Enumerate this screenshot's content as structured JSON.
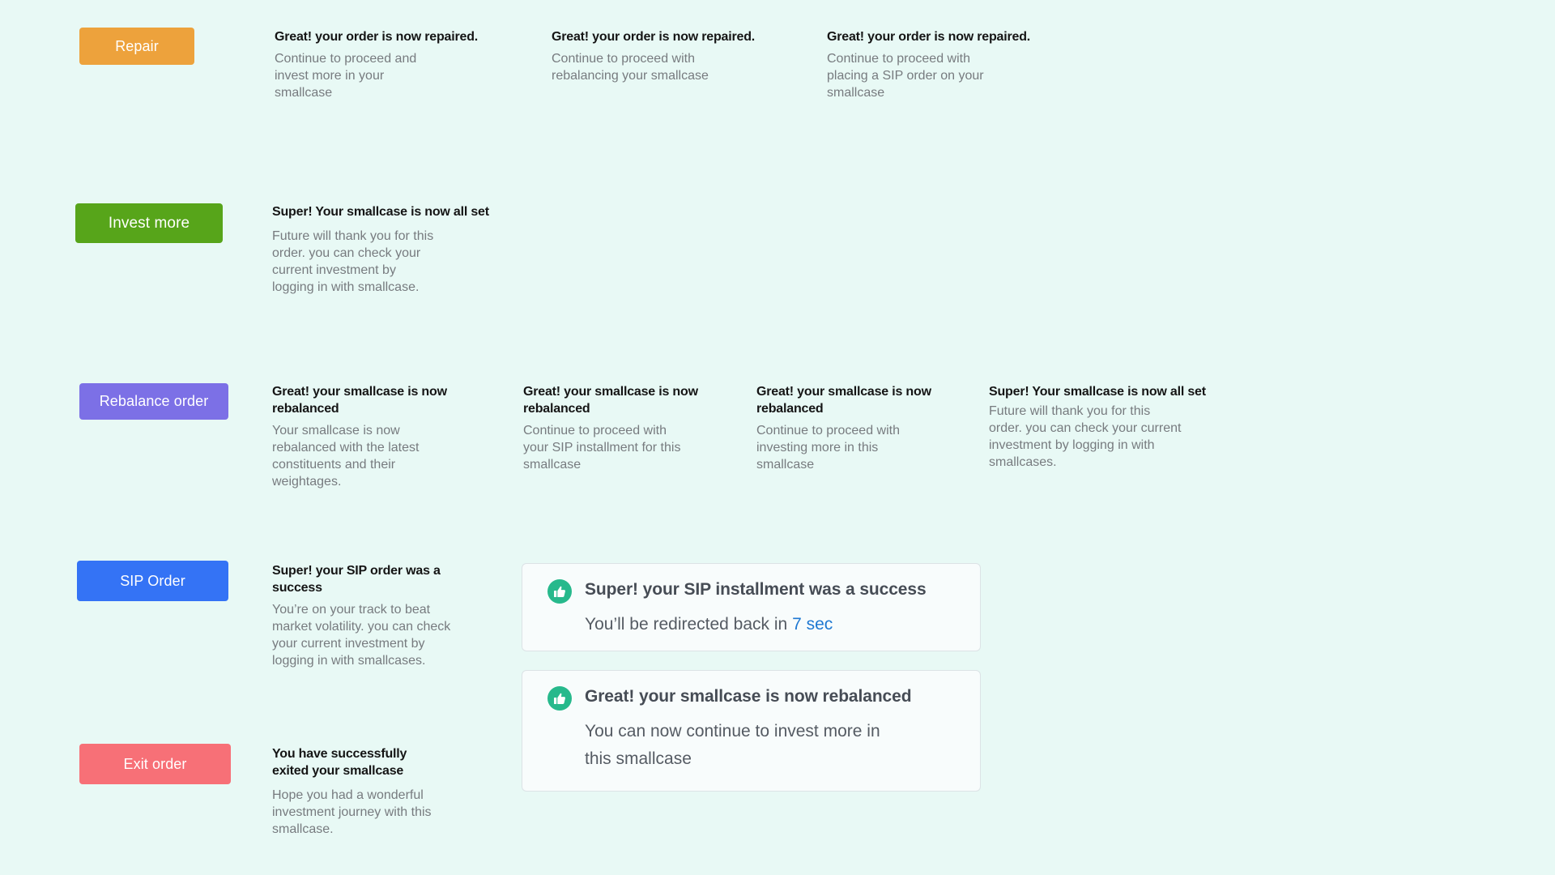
{
  "colors": {
    "background": "#E8F9F5",
    "repair": "#EDA23C",
    "invest_more": "#57A51A",
    "rebalance": "#7C70E6",
    "sip": "#3473F5",
    "exit": "#F77077",
    "success_icon": "#27B98C",
    "link": "#1E78D2"
  },
  "rows": {
    "repair": {
      "button_label": "Repair",
      "messages": [
        {
          "title": [
            "Great! your order is now repaired."
          ],
          "body": [
            "Continue to proceed and",
            "invest more in your",
            "smallcase"
          ]
        },
        {
          "title": [
            "Great! your order is now repaired."
          ],
          "body": [
            "Continue to proceed with",
            "rebalancing your smallcase"
          ]
        },
        {
          "title": [
            "Great! your order is now repaired."
          ],
          "body": [
            "Continue to proceed with",
            "placing a SIP order on your",
            "smallcase"
          ]
        }
      ]
    },
    "invest_more": {
      "button_label": "Invest more",
      "messages": [
        {
          "title": [
            "Super! Your smallcase is now all set"
          ],
          "body": [
            "Future will thank you for this",
            "order. you can check your",
            "current investment by",
            "logging in with smallcase."
          ]
        }
      ]
    },
    "rebalance": {
      "button_label": "Rebalance order",
      "messages": [
        {
          "title": [
            "Great! your smallcase is now",
            "rebalanced"
          ],
          "body": [
            "Your smallcase is now",
            "rebalanced with the latest",
            "constituents and their",
            "weightages."
          ]
        },
        {
          "title": [
            "Great! your smallcase is now",
            "rebalanced"
          ],
          "body": [
            "Continue to proceed with",
            "your SIP installment for this",
            "smallcase"
          ]
        },
        {
          "title": [
            "Great! your smallcase is now",
            "rebalanced"
          ],
          "body": [
            "Continue to proceed with",
            "investing more in this",
            "smallcase"
          ]
        },
        {
          "title": [
            "Super! Your smallcase is now all set"
          ],
          "body": [
            "Future will thank you for this",
            "order. you can check your current",
            "investment by logging in with",
            "smallcases."
          ]
        }
      ]
    },
    "sip": {
      "button_label": "SIP Order",
      "messages": [
        {
          "title": [
            "Super! your SIP order was a",
            "success"
          ],
          "body": [
            "You’re on your track to beat",
            "market volatility. you can check",
            "your current investment by",
            "logging in with smallcases."
          ]
        }
      ]
    },
    "exit": {
      "button_label": "Exit order",
      "messages": [
        {
          "title": [
            "You have successfully",
            "exited your smallcase"
          ],
          "body": [
            "Hope you had a wonderful",
            "investment journey with this",
            "smallcase."
          ]
        }
      ]
    }
  },
  "cards": [
    {
      "icon": "thumbs-up-icon",
      "title": "Super! your SIP installment was a success",
      "body_prefix": "You’ll be redirected back in ",
      "countdown": "7 sec"
    },
    {
      "icon": "thumbs-up-icon",
      "title": "Great! your smallcase is now rebalanced",
      "body": [
        "You can now continue to invest more in",
        "this smallcase"
      ]
    }
  ]
}
